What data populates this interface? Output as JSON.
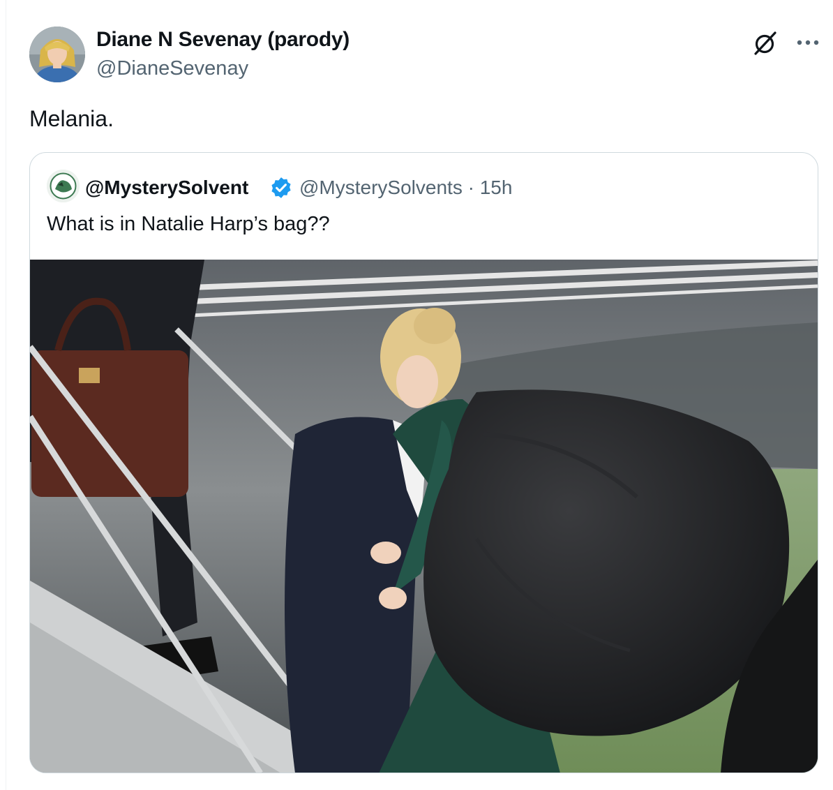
{
  "tweet": {
    "author": {
      "name": "Diane N Sevenay (parody)",
      "handle": "@DianeSevenay"
    },
    "text": "Melania.",
    "actions": {
      "grok_icon": "slashed-circle-icon",
      "more_icon": "more-dots-icon"
    }
  },
  "quoted_tweet": {
    "author": {
      "name": "@MysterySolvent",
      "verified": true,
      "meta": "@MysterySolvents · 15h"
    },
    "text": "What is in Natalie Harp’s bag??",
    "photo": {
      "icon": "photo"
    }
  },
  "colors": {
    "text_primary": "#0f1419",
    "text_secondary": "#536471",
    "border": "#cfd9de",
    "verified_blue": "#1d9bf0"
  }
}
